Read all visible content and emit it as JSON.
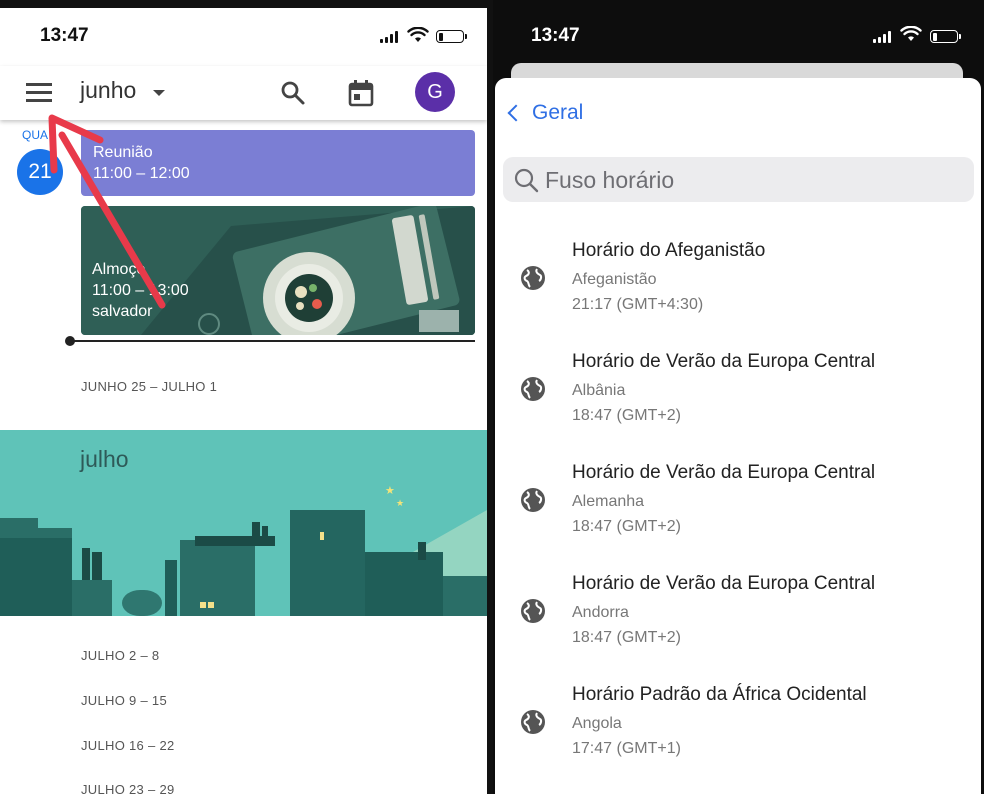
{
  "left_phone": {
    "status": {
      "time": "13:47"
    },
    "appbar": {
      "month": "junho",
      "avatar_letter": "G"
    },
    "today": {
      "dayname": "QUA",
      "daynum": "21"
    },
    "events": [
      {
        "title": "Reunião",
        "hours": "11:00 – 12:00",
        "color": "#7b7ed4"
      },
      {
        "title": "Almoço",
        "hours": "11:00 – 13:00",
        "location": "salvador",
        "color": "#2f5f56"
      }
    ],
    "weeks_before": [
      "JUNHO 25 – JULHO 1"
    ],
    "month_banner": "julho",
    "weeks_after": [
      "JULHO 2 – 8",
      "JULHO 9 – 15",
      "JULHO 16 – 22",
      "JULHO 23 – 29"
    ],
    "accent": "#1a73e8",
    "annotation_arrow_color": "#e83a4a"
  },
  "right_phone": {
    "status": {
      "time": "13:47"
    },
    "back_label": "Geral",
    "search_placeholder": "Fuso horário",
    "timezones": [
      {
        "name": "Horário do Afeganistão",
        "country": "Afeganistão",
        "offset": "21:17 (GMT+4:30)",
        "icon": "globe-icon"
      },
      {
        "name": "Horário de Verão da Europa Central",
        "country": "Albânia",
        "offset": "18:47 (GMT+2)",
        "icon": "globe-icon"
      },
      {
        "name": "Horário de Verão da Europa Central",
        "country": "Alemanha",
        "offset": "18:47 (GMT+2)",
        "icon": "globe-icon"
      },
      {
        "name": "Horário de Verão da Europa Central",
        "country": "Andorra",
        "offset": "18:47 (GMT+2)",
        "icon": "globe-icon"
      },
      {
        "name": "Horário Padrão da África Ocidental",
        "country": "Angola",
        "offset": "17:47 (GMT+1)",
        "icon": "globe-icon"
      }
    ],
    "accent": "#2f6fe4"
  }
}
